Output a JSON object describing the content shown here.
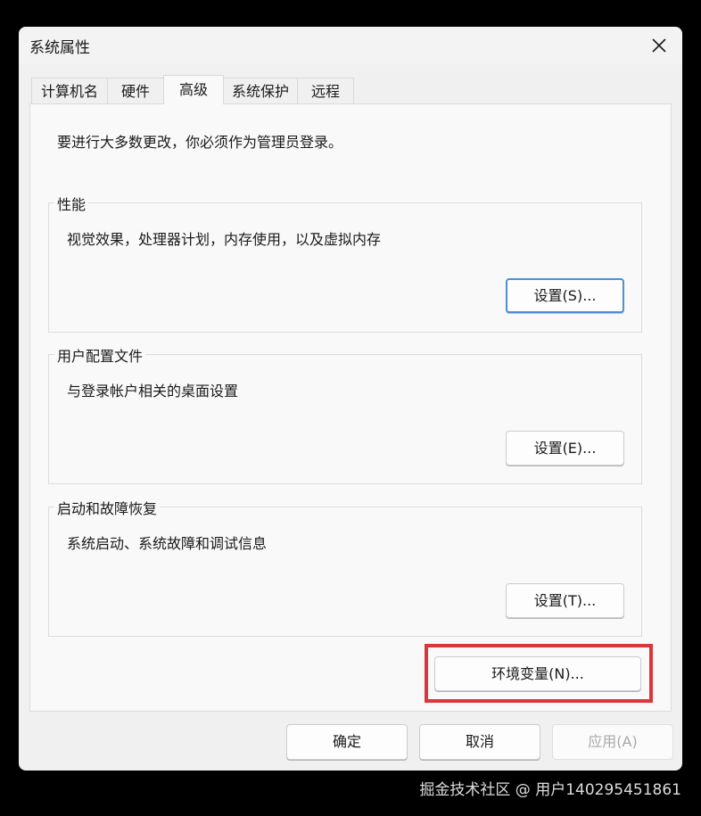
{
  "window": {
    "title": "系统属性",
    "close_icon": "close-icon"
  },
  "tabs": [
    {
      "label": "计算机名",
      "active": false
    },
    {
      "label": "硬件",
      "active": false
    },
    {
      "label": "高级",
      "active": true
    },
    {
      "label": "系统保护",
      "active": false
    },
    {
      "label": "远程",
      "active": false
    }
  ],
  "advanced": {
    "admin_note": "要进行大多数更改，你必须作为管理员登录。",
    "performance": {
      "label": "性能",
      "description": "视觉效果，处理器计划，内存使用，以及虚拟内存",
      "button": "设置(S)..."
    },
    "user_profiles": {
      "label": "用户配置文件",
      "description": "与登录帐户相关的桌面设置",
      "button": "设置(E)..."
    },
    "startup_recovery": {
      "label": "启动和故障恢复",
      "description": "系统启动、系统故障和调试信息",
      "button": "设置(T)..."
    },
    "env_button": "环境变量(N)...",
    "highlight_color": "#d9373b"
  },
  "footer": {
    "ok": "确定",
    "cancel": "取消",
    "apply": "应用(A)"
  },
  "watermark": "掘金技术社区 @ 用户140295451861"
}
